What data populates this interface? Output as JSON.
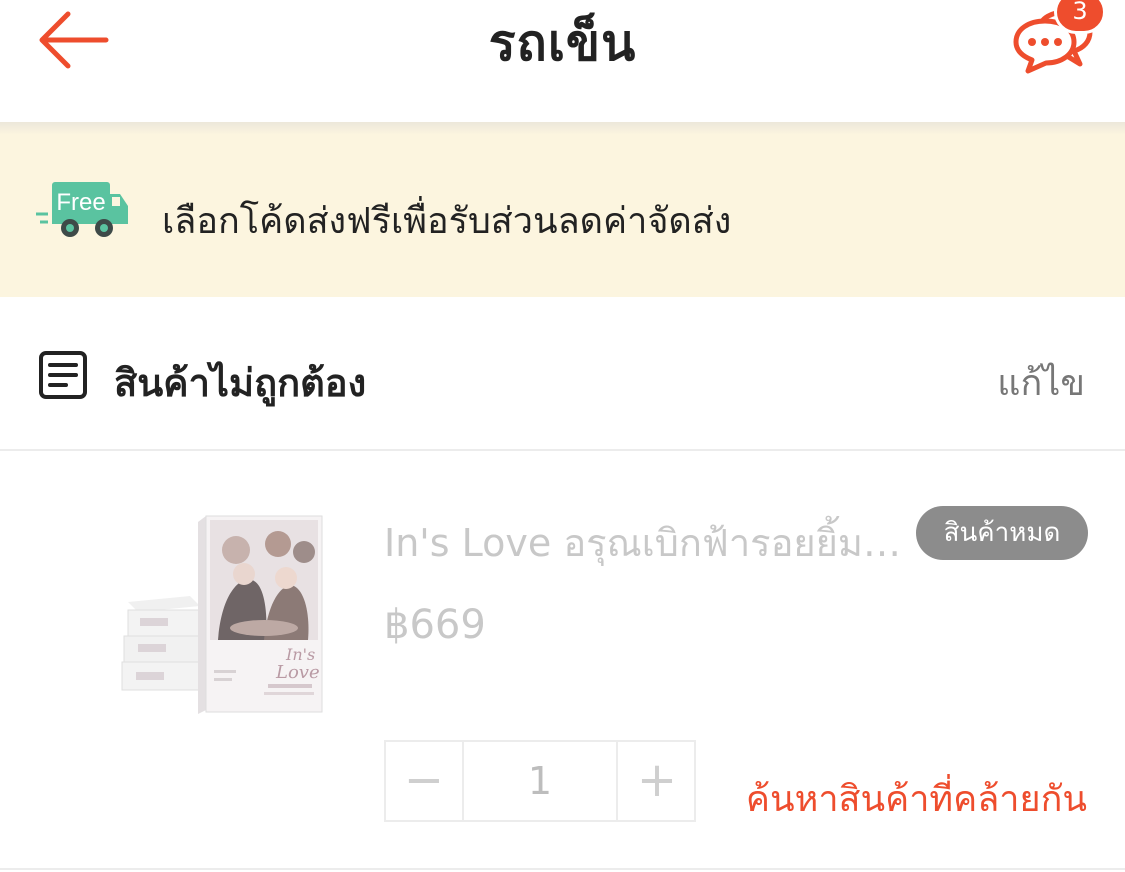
{
  "header": {
    "title": "รถเข็น",
    "chat_badge_count": "3",
    "icons": {
      "back": "back-arrow-icon",
      "chat": "chat-bubbles-icon"
    }
  },
  "banner": {
    "truck_label": "Free",
    "text": "เลือกโค้ดส่งฟรีเพื่อรับส่วนลดค่าจัดส่ง",
    "icon": "free-shipping-truck-icon"
  },
  "shop": {
    "name": "สินค้าไม่ถูกต้อง",
    "edit_label": "แก้ไข",
    "icon": "document-list-icon"
  },
  "product": {
    "name": "In's Love อรุณเบิกฟ้ารอยยิ้มของเธอ",
    "status_badge": "สินค้าหมด",
    "price": "฿669",
    "quantity": "1",
    "minus_label": "−",
    "plus_label": "+",
    "find_similar_label": "ค้นหาสินค้าที่คล้ายกัน"
  },
  "colors": {
    "accent": "#ee4d2d",
    "banner_bg": "#fcf5df",
    "truck_green": "#5ac3a0",
    "disabled_text": "#c8c8c8",
    "badge_gray": "#8c8c8c"
  }
}
